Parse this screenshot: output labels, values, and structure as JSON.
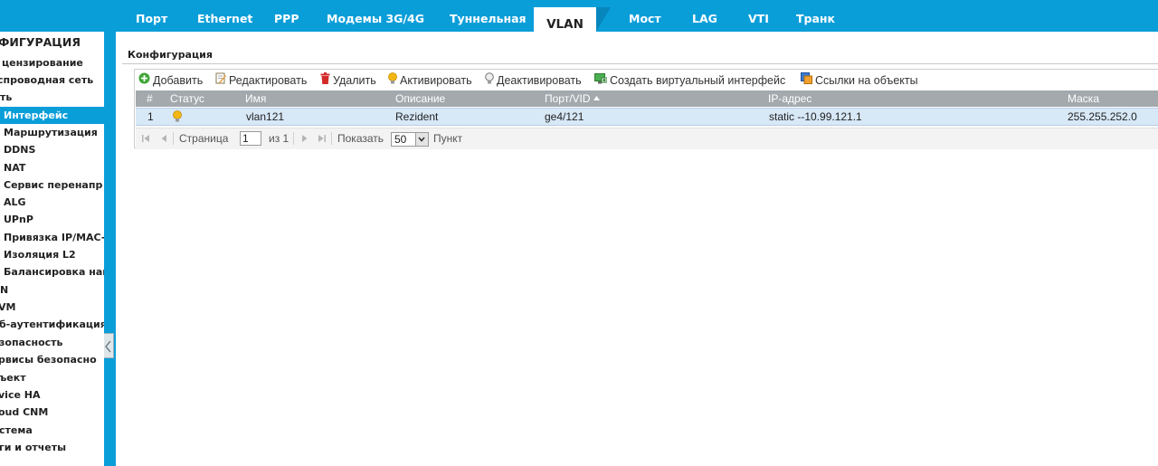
{
  "tabs": [
    {
      "label": "Порт"
    },
    {
      "label": "Ethernet"
    },
    {
      "label": "PPP"
    },
    {
      "label": "Модемы 3G/4G"
    },
    {
      "label": "Туннельная"
    },
    {
      "label": "VLAN",
      "active": true
    },
    {
      "label": "Мост"
    },
    {
      "label": "LAG"
    },
    {
      "label": "VTI"
    },
    {
      "label": "Транк"
    }
  ],
  "sidebar": {
    "items": [
      {
        "label": "ФИГУРАЦИЯ"
      },
      {
        "label": "цензирование"
      },
      {
        "label": "спроводная сеть"
      },
      {
        "label": "ть"
      },
      {
        "label": "Интерфейс",
        "selected": true
      },
      {
        "label": "Маршрутизация"
      },
      {
        "label": "DDNS"
      },
      {
        "label": "NAT"
      },
      {
        "label": "Сервис перенапр"
      },
      {
        "label": "ALG"
      },
      {
        "label": "UPnP"
      },
      {
        "label": "Привязка IP/MAC-а"
      },
      {
        "label": "Изоляция L2"
      },
      {
        "label": "Балансировка наг"
      },
      {
        "label": "N"
      },
      {
        "label": "VM"
      },
      {
        "label": "б-аутентификация"
      },
      {
        "label": "зопасность"
      },
      {
        "label": "рвисы безопасно"
      },
      {
        "label": "ъект"
      },
      {
        "label": "vice HA"
      },
      {
        "label": "oud CNM"
      },
      {
        "label": "стема"
      },
      {
        "label": "ги и отчеты"
      }
    ]
  },
  "section": {
    "title": "Конфигурация"
  },
  "toolbar": {
    "add": "Добавить",
    "edit": "Редактировать",
    "delete": "Удалить",
    "activate": "Активировать",
    "deactivate": "Деактивировать",
    "create_virtual": "Создать виртуальный интерфейс",
    "references": "Ссылки на объекты"
  },
  "table": {
    "columns": {
      "num": "#",
      "status": "Статус",
      "name": "Имя",
      "description": "Описание",
      "port_vid": "Порт/VID",
      "ip": "IP-адрес",
      "mask": "Маска"
    },
    "rows": [
      {
        "num": "1",
        "status_icon": "bulb-on-icon",
        "name": "vlan121",
        "description": "Rezident",
        "port_vid": "ge4/121",
        "ip": "static --10.99.121.1",
        "mask": "255.255.252.0"
      }
    ]
  },
  "pager": {
    "page_label": "Страница",
    "page_value": "1",
    "of_label": "из 1",
    "show_label": "Показать",
    "show_value": "50",
    "items_label": "Пункт"
  },
  "colors": {
    "accent": "#0a9ed9",
    "header_gray": "#a3a9ad",
    "row_selected": "#d7e8f7"
  }
}
